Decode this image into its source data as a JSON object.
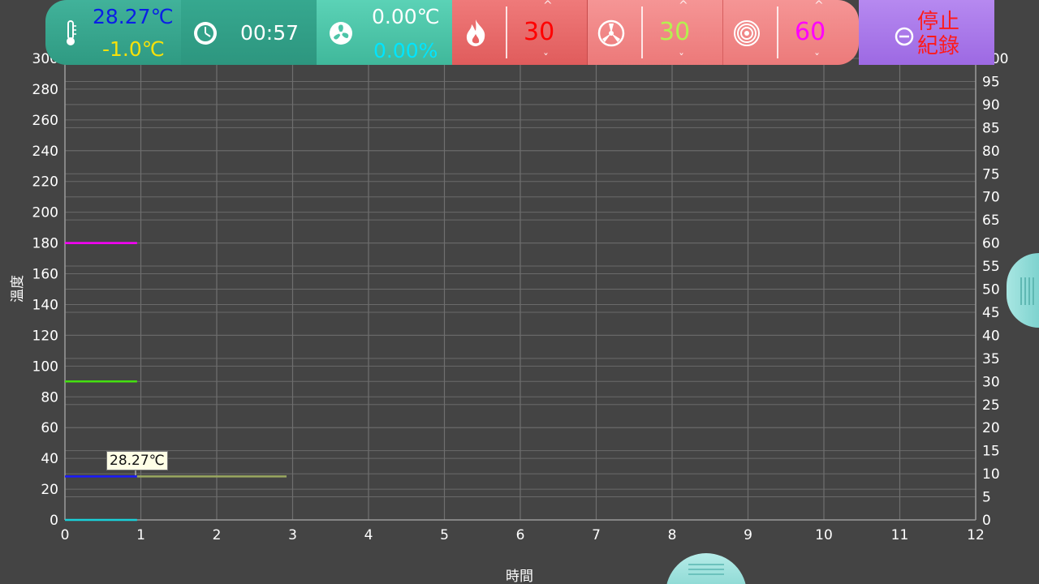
{
  "toolbar": {
    "temp_primary": "28.27℃",
    "temp_secondary": "-1.0℃",
    "timer": "00:57",
    "fan_temp": "0.00℃",
    "fan_percent": "0.00%",
    "fire_value": "30",
    "wind_value": "30",
    "drum_value": "60",
    "stop_label": "停止紀錄",
    "colors": {
      "temp_primary": "#0a1ee6",
      "temp_secondary": "#f5e10a",
      "fan_percent": "#00e5ff",
      "fire_value": "#ff0000",
      "wind_value": "#b4f050",
      "drum_value": "#ff00ff",
      "stop_label": "#ff1a1a"
    },
    "icons": [
      "thermometer-icon",
      "clock-icon",
      "fan-icon",
      "flame-icon",
      "airflow-icon",
      "drum-icon",
      "minus-circle-icon"
    ]
  },
  "tooltip": "28.27℃",
  "chart_data": {
    "type": "line",
    "xlabel": "時間",
    "ylabel": "溫度",
    "xlim": [
      0,
      12
    ],
    "ylim": [
      0,
      300
    ],
    "y2lim": [
      0,
      100
    ],
    "x_ticks": [
      "0",
      "1",
      "2",
      "3",
      "4",
      "5",
      "6",
      "7",
      "8",
      "9",
      "10",
      "11",
      "12"
    ],
    "y_ticks": [
      "0",
      "20",
      "40",
      "60",
      "80",
      "100",
      "120",
      "140",
      "160",
      "180",
      "200",
      "220",
      "240",
      "260",
      "280",
      "300"
    ],
    "y2_ticks": [
      "0",
      "5",
      "10",
      "15",
      "20",
      "25",
      "30",
      "35",
      "40",
      "45",
      "50",
      "55",
      "60",
      "65",
      "70",
      "75",
      "80",
      "85",
      "90",
      "95",
      "100"
    ],
    "grid": true,
    "series": [
      {
        "color": "#ff00ff",
        "axis": "y2",
        "x": [
          0,
          0.95
        ],
        "y": [
          60,
          60
        ]
      },
      {
        "color": "#44e010",
        "axis": "y2",
        "x": [
          0,
          0.95
        ],
        "y": [
          30,
          30
        ]
      },
      {
        "color": "#1a1aff",
        "axis": "y",
        "x": [
          0,
          0.95
        ],
        "y": [
          28.27,
          28.27
        ]
      },
      {
        "color": "#9aa860",
        "axis": "y",
        "x": [
          0.95,
          2.92
        ],
        "y": [
          28.27,
          28.27
        ]
      },
      {
        "color": "#19d0d8",
        "axis": "y2",
        "x": [
          0,
          0.95
        ],
        "y": [
          0,
          0
        ]
      }
    ]
  }
}
